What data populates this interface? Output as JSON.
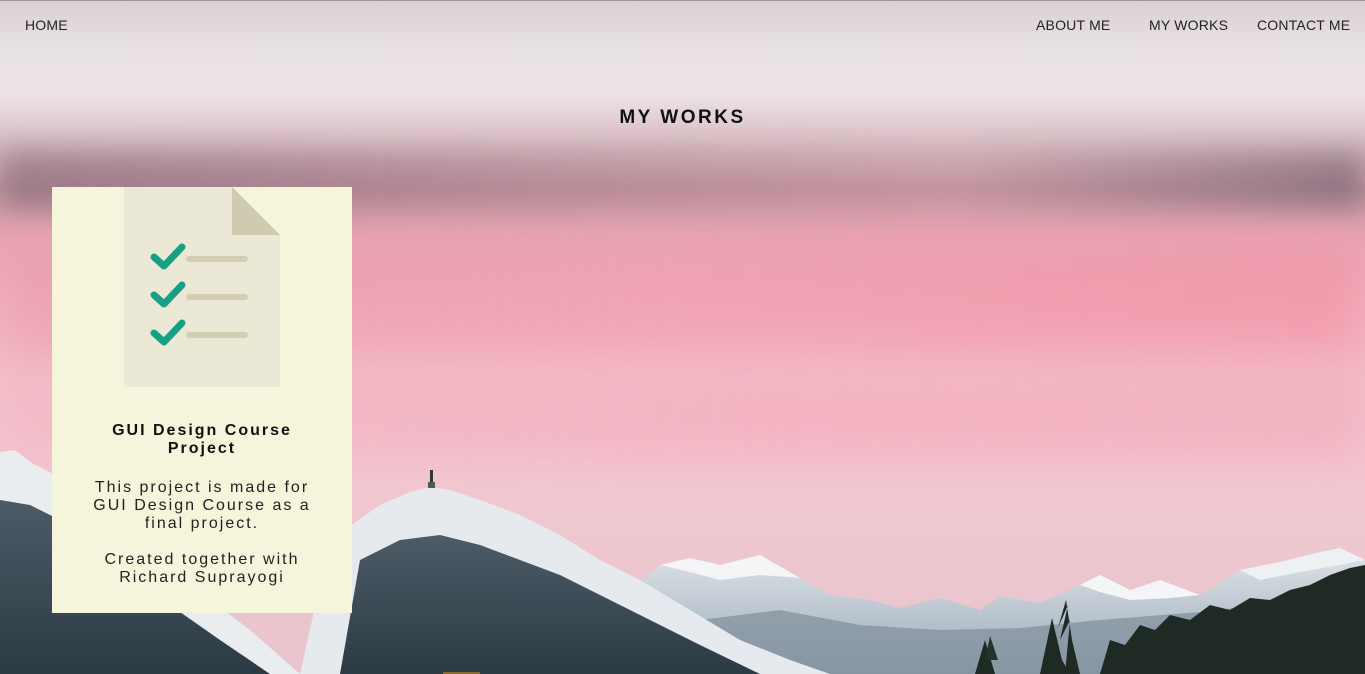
{
  "nav": {
    "home": "HOME",
    "about": "ABOUT ME",
    "works": "MY WORKS",
    "contact": "CONTACT ME"
  },
  "page": {
    "title": "MY WORKS"
  },
  "projects": [
    {
      "icon": "checklist-document-icon",
      "title": "GUI Design Course Project",
      "description": "This project is made for GUI Design Course as a final project.",
      "credit": "Created together with Richard Suprayogi"
    }
  ],
  "colors": {
    "card_background": "#f5f5dc",
    "checkmark": "#17a083",
    "document": "#ebe8d6",
    "document_fold": "#cfcbb0",
    "line": "#d2ceb3"
  }
}
